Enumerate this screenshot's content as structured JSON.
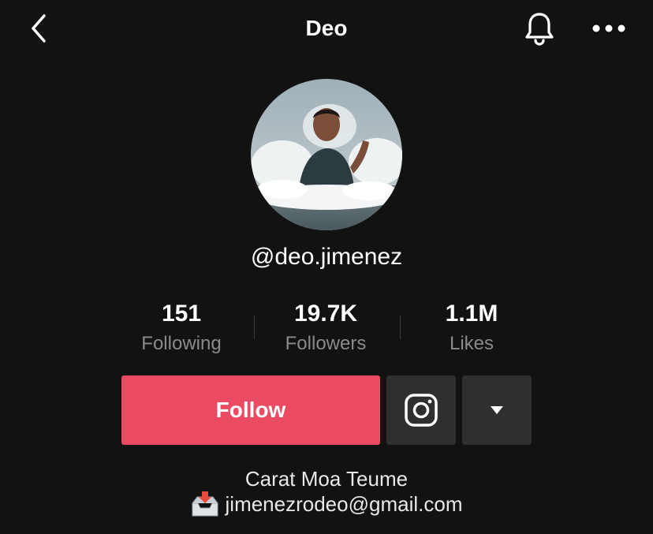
{
  "header": {
    "title": "Deo",
    "back_icon": "chevron-left-icon",
    "bell_icon": "bell-icon",
    "more_icon": "more-dots-icon"
  },
  "profile": {
    "username": "@deo.jimenez",
    "avatar_icon": "profile-photo"
  },
  "stats": [
    {
      "value": "151",
      "label": "Following"
    },
    {
      "value": "19.7K",
      "label": "Followers"
    },
    {
      "value": "1.1M",
      "label": "Likes"
    }
  ],
  "actions": {
    "follow_label": "Follow",
    "instagram_icon": "instagram-icon",
    "dropdown_icon": "caret-down-icon"
  },
  "bio": {
    "line1": "Carat Moa Teume",
    "email": "jimenezrodeo@gmail.com",
    "email_icon": "inbox-tray-icon"
  },
  "colors": {
    "background": "#121212",
    "accent": "#ea4b62",
    "button_dark": "#2f2f2f",
    "muted_text": "#8a8a8a"
  }
}
